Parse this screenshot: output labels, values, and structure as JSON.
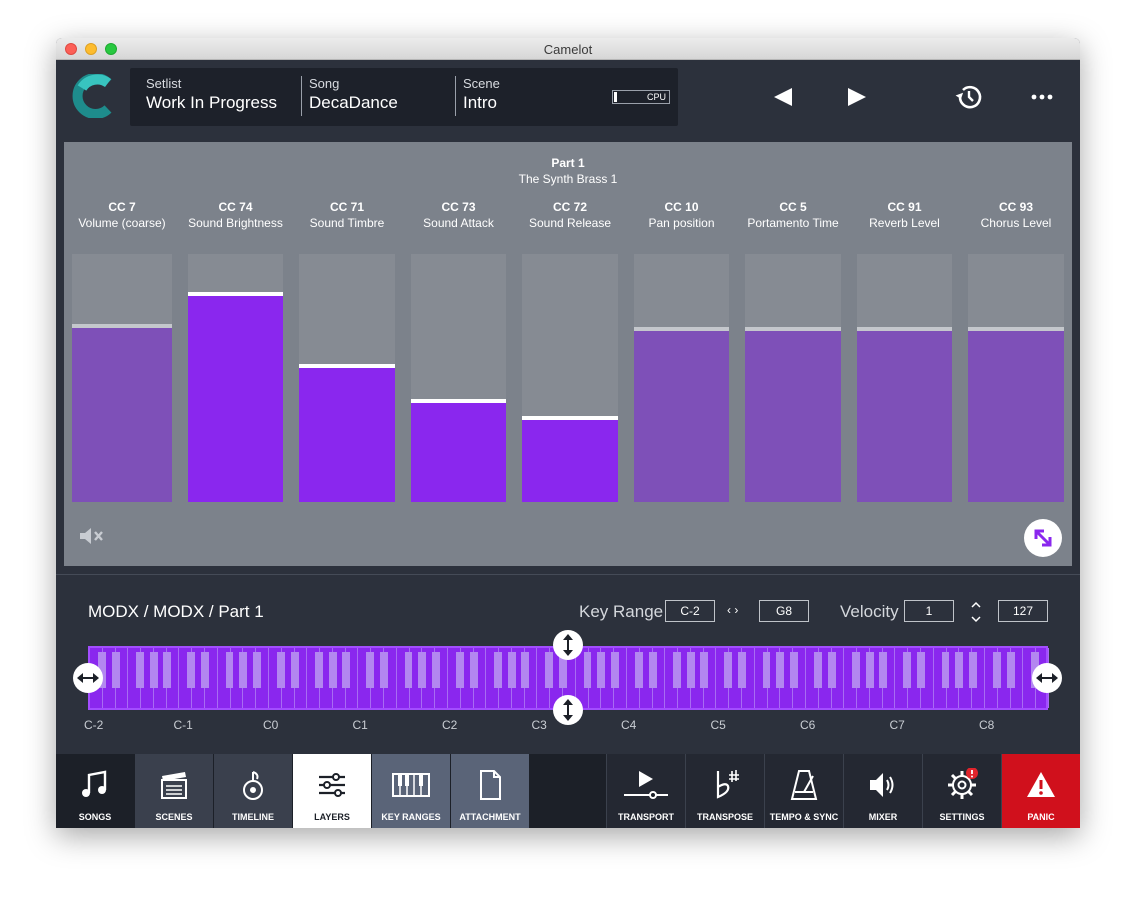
{
  "window": {
    "title": "Camelot"
  },
  "header": {
    "setlist_label": "Setlist",
    "setlist_value": "Work In Progress",
    "song_label": "Song",
    "song_value": "DecaDance",
    "scene_label": "Scene",
    "scene_value": "Intro",
    "cpu_label": "CPU",
    "cpu_level_fraction": 0.05
  },
  "part": {
    "title": "Part 1",
    "subtitle": "The Synth Brass 1"
  },
  "sliders": [
    {
      "cc": "CC 7",
      "name": "Volume (coarse)",
      "level_fraction": 0.7,
      "active": false
    },
    {
      "cc": "CC 74",
      "name": "Sound Brightness",
      "level_fraction": 0.83,
      "active": true
    },
    {
      "cc": "CC 71",
      "name": "Sound Timbre",
      "level_fraction": 0.54,
      "active": true
    },
    {
      "cc": "CC 73",
      "name": "Sound Attack",
      "level_fraction": 0.4,
      "active": true
    },
    {
      "cc": "CC 72",
      "name": "Sound Release",
      "level_fraction": 0.33,
      "active": true
    },
    {
      "cc": "CC 10",
      "name": "Pan position",
      "level_fraction": 0.69,
      "active": false
    },
    {
      "cc": "CC 5",
      "name": "Portamento Time",
      "level_fraction": 0.69,
      "active": false
    },
    {
      "cc": "CC 91",
      "name": "Reverb Level",
      "level_fraction": 0.69,
      "active": false
    },
    {
      "cc": "CC 93",
      "name": "Chorus Level",
      "level_fraction": 0.69,
      "active": false
    }
  ],
  "lower": {
    "title": "MODX / MODX / Part 1",
    "key_range_label": "Key Range",
    "key_low": "C-2",
    "key_high": "G8",
    "velocity_label": "Velocity",
    "vel_low": "1",
    "vel_high": "127",
    "octaves": [
      "C-2",
      "C-1",
      "C0",
      "C1",
      "C2",
      "C3",
      "C4",
      "C5",
      "C6",
      "C7",
      "C8"
    ]
  },
  "tabs": [
    {
      "id": "songs",
      "label": "SONGS",
      "icon": "music-note-icon"
    },
    {
      "id": "scenes",
      "label": "SCENES",
      "icon": "clapperboard-icon"
    },
    {
      "id": "timeline",
      "label": "TIMELINE",
      "icon": "timeline-icon"
    },
    {
      "id": "layers",
      "label": "LAYERS",
      "icon": "sliders-icon"
    },
    {
      "id": "keyranges",
      "label": "KEY RANGES",
      "icon": "piano-icon"
    },
    {
      "id": "attachment",
      "label": "ATTACHMENT",
      "icon": "document-icon"
    },
    {
      "id": "transport",
      "label": "TRANSPORT",
      "icon": "play-icon"
    },
    {
      "id": "transpose",
      "label": "TRANSPOSE",
      "icon": "flat-sharp-icon"
    },
    {
      "id": "tempo",
      "label": "TEMPO & SYNC",
      "icon": "metronome-icon"
    },
    {
      "id": "mixer",
      "label": "MIXER",
      "icon": "speaker-icon"
    },
    {
      "id": "settings",
      "label": "SETTINGS",
      "icon": "gear-icon"
    },
    {
      "id": "panic",
      "label": "PANIC",
      "icon": "warning-icon"
    }
  ],
  "colors": {
    "accent": "#8a27ee",
    "accent_inactive": "#7e50b8",
    "panic": "#d0101c",
    "active_tab_bg": "#ffffff",
    "selected_tab_bg": "#5a6478",
    "tab_bg": "#3a404d"
  }
}
